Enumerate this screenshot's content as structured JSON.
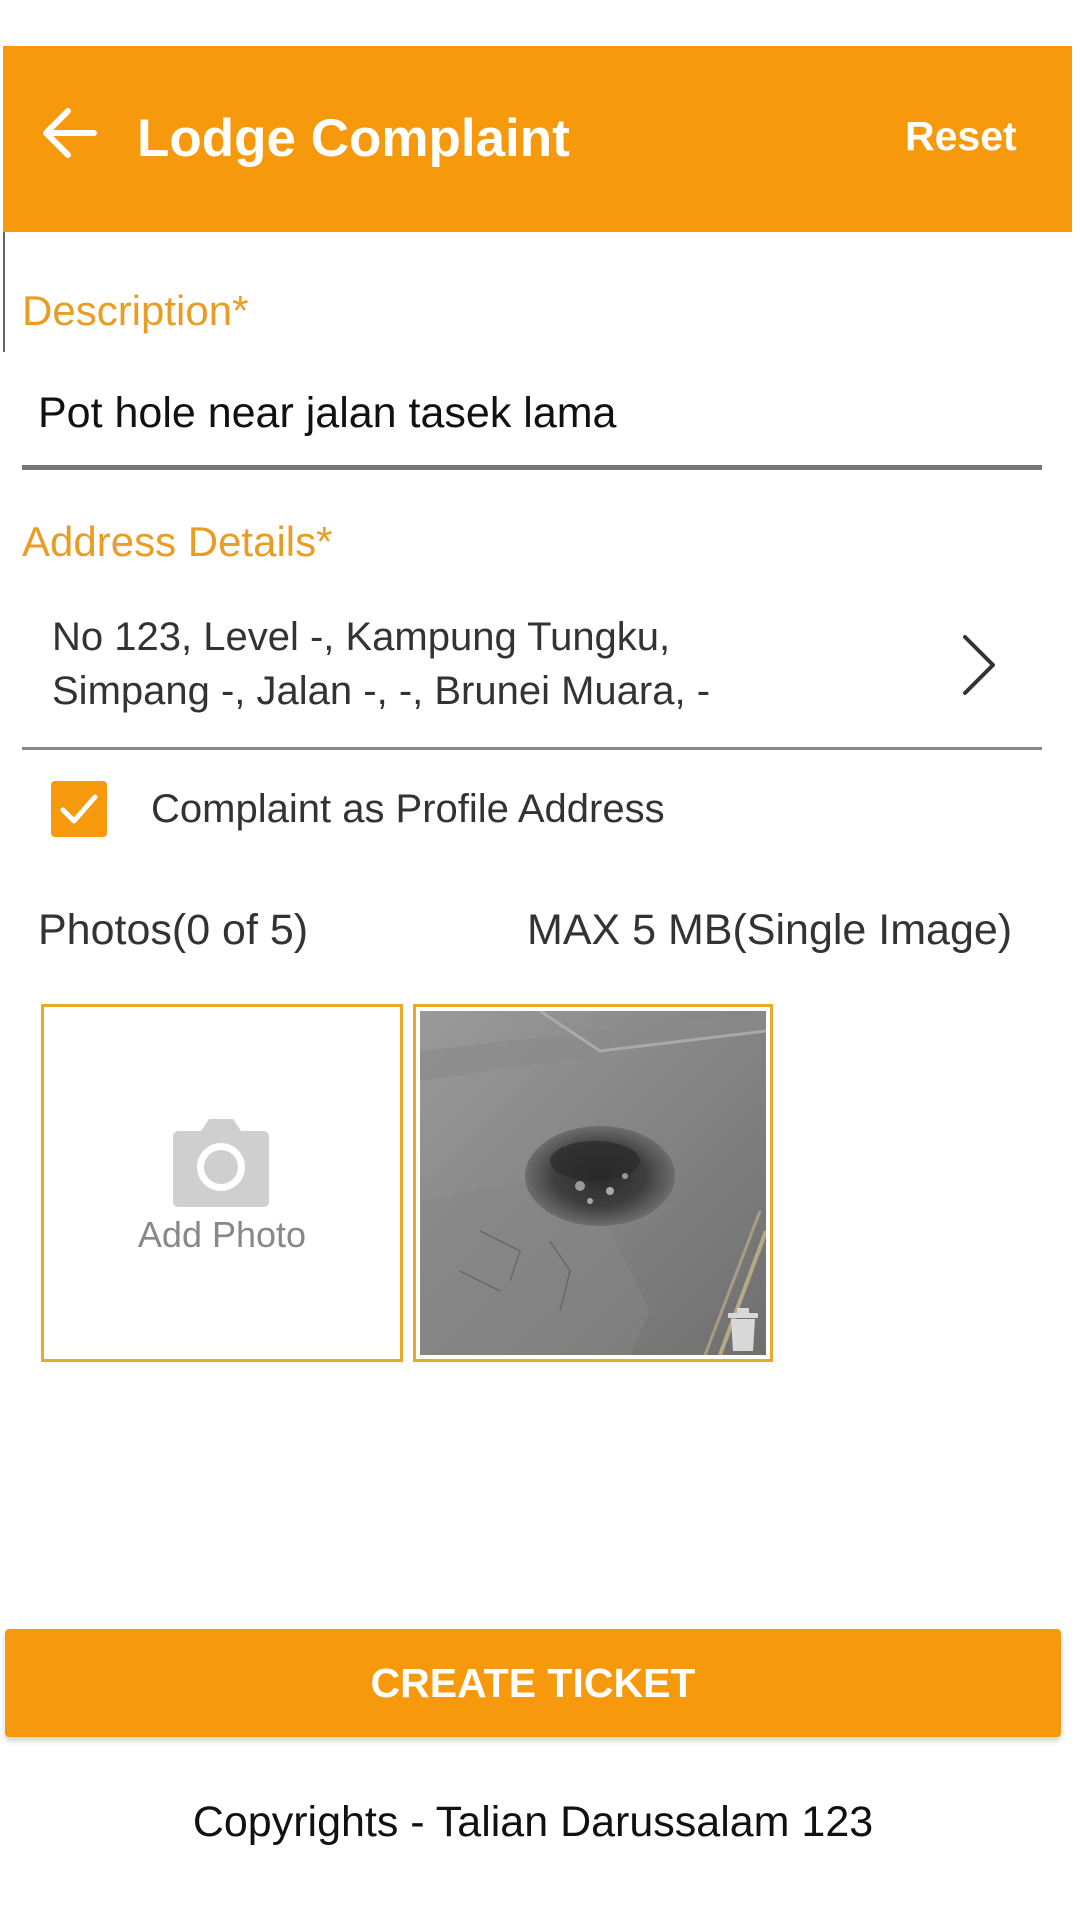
{
  "colors": {
    "accent": "#f7990c",
    "label": "#e99d24",
    "border": "#e9aa2c"
  },
  "header": {
    "back_icon": "arrow-left-icon",
    "title": "Lodge Complaint",
    "reset_label": "Reset"
  },
  "form": {
    "description_label": "Description*",
    "description_value": "Pot hole near jalan tasek lama",
    "address_label": "Address Details*",
    "address_line1": "No 123, Level -, Kampung Tungku,",
    "address_line2": "Simpang -, Jalan -, -, Brunei Muara, -",
    "address_chevron_icon": "chevron-right-icon",
    "profile_address_checked": true,
    "profile_address_label": "Complaint as Profile Address"
  },
  "photos": {
    "count_label": "Photos(0 of 5)",
    "max_label": "MAX 5 MB(Single Image)",
    "add_icon": "camera-icon",
    "add_label": "Add Photo",
    "delete_icon": "trash-icon"
  },
  "actions": {
    "create_label": "CREATE TICKET"
  },
  "footer": {
    "copyright": "Copyrights - Talian Darussalam 123"
  }
}
